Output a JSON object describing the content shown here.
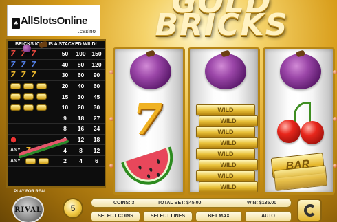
{
  "logo": {
    "main": "AllSlotsOnline",
    "sub": ".casino"
  },
  "title": {
    "line1": "GOLD",
    "line2": "BRICKS"
  },
  "paytable": {
    "header": "BRICKS ICON IS A STACKED WILD!",
    "rows": [
      {
        "symbols": [
          "seven-red",
          "seven-red",
          "seven-red"
        ],
        "any": "",
        "pays": [
          "50",
          "100",
          "150"
        ]
      },
      {
        "symbols": [
          "seven-blue",
          "seven-blue",
          "seven-blue"
        ],
        "any": "",
        "pays": [
          "40",
          "80",
          "120"
        ]
      },
      {
        "symbols": [
          "seven-gold",
          "seven-gold",
          "seven-gold"
        ],
        "any": "",
        "pays": [
          "30",
          "60",
          "90"
        ]
      },
      {
        "symbols": [
          "bar-triple",
          "bar-triple",
          "bar-triple"
        ],
        "any": "",
        "pays": [
          "20",
          "40",
          "60"
        ]
      },
      {
        "symbols": [
          "bar-double",
          "bar-double",
          "bar-double"
        ],
        "any": "",
        "pays": [
          "15",
          "30",
          "45"
        ]
      },
      {
        "symbols": [
          "bar-single",
          "bar-single",
          "bar-single"
        ],
        "any": "",
        "pays": [
          "10",
          "20",
          "30"
        ]
      },
      {
        "symbols": [
          "plum",
          "plum",
          "plum"
        ],
        "any": "",
        "pays": [
          "9",
          "18",
          "27"
        ]
      },
      {
        "symbols": [
          "melon",
          "melon",
          "melon"
        ],
        "any": "",
        "pays": [
          "8",
          "16",
          "24"
        ]
      },
      {
        "symbols": [
          "cherry",
          "cherry",
          "cherry"
        ],
        "any": "",
        "pays": [
          "6",
          "12",
          "18"
        ]
      },
      {
        "symbols": [
          "seven-any",
          "seven-any"
        ],
        "any": "ANY",
        "pays": [
          "4",
          "8",
          "12"
        ]
      },
      {
        "symbols": [
          "bar-any",
          "bar-any"
        ],
        "any": "ANY",
        "pays": [
          "2",
          "4",
          "6"
        ]
      }
    ]
  },
  "reels": [
    {
      "symbols": [
        "plum",
        "seven",
        "watermelon"
      ]
    },
    {
      "symbols": [
        "plum",
        "wild-bricks"
      ],
      "wild_label": "WILD"
    },
    {
      "symbols": [
        "plum",
        "cherries",
        "bar"
      ],
      "bar_label": "BAR"
    }
  ],
  "bottom": {
    "coin_value": "5",
    "coins_label": "COINS: 3",
    "total_bet_label": "TOTAL BET: $45.00",
    "win_label": "WIN: $135.00",
    "play_for_real": "PLAY FOR REAL",
    "rival": "RIVAL",
    "buttons": [
      "SELECT COINS",
      "SELECT LINES",
      "BET MAX",
      "AUTO"
    ]
  },
  "colors": {
    "gold": "#d89d1a",
    "paytable_bg": "#0d0d0d",
    "reel_frame": "#b78615"
  }
}
